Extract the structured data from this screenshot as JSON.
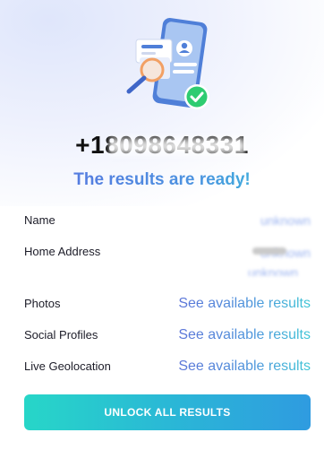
{
  "header": {
    "phone_number": "+18098648331",
    "status": "The results are ready!"
  },
  "rows": [
    {
      "label": "Name",
      "value": "unknown",
      "blurred": true
    },
    {
      "label": "Home Address",
      "value": "unknown",
      "blurred": true
    },
    {
      "label": "Photos",
      "value": "See available results",
      "blurred": false
    },
    {
      "label": "Social Profiles",
      "value": "See available results",
      "blurred": false
    },
    {
      "label": "Live Geolocation",
      "value": "See available results",
      "blurred": false
    }
  ],
  "cta": {
    "label": "UNLOCK ALL RESULTS"
  },
  "icons": {
    "hero": "phone-search-illustration",
    "check": "checkmark-badge-icon",
    "magnifier": "magnifying-glass-icon"
  },
  "colors": {
    "accent_start": "#5b6ee0",
    "accent_end": "#33c8d9",
    "button_start": "#27d6c8",
    "button_end": "#2f9be0",
    "check_green": "#2ecc71"
  }
}
